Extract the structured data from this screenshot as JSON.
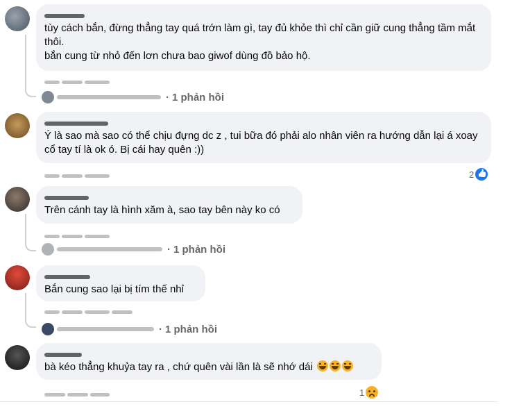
{
  "comments": [
    {
      "text": "tùy cách bắn, đừng thẳng tay quá trớn làm gì, tay đủ khỏe thì chỉ cần giữ cung thẳng tầm mắt thôi.\nbắn cung từ nhỏ đến lơn chưa bao giwof dùng đồ bảo hộ.",
      "reply_count": "1 phản hồi"
    },
    {
      "text": "Ý là sao mà sao có thể chịu đựng dc z , tui bữa đó phải alo nhân viên ra hướng dẫn lại á xoay cổ tay tí là ok ó. Bị cái hay quên :))",
      "reaction_count": "2",
      "reaction_icon": "like-icon"
    },
    {
      "text": "Trên cánh tay là hình xăm à, sao tay bên này ko có",
      "reply_count": "1 phản hồi"
    },
    {
      "text": "Bắn cung sao lại bị tím thế nhỉ",
      "reply_count": "1 phản hồi"
    },
    {
      "text": "bà kéo thẳng khuỷa tay ra , chứ quên vài lần là sẽ nhớ dái",
      "reaction_count": "1",
      "reaction_icon": "sad-icon"
    }
  ],
  "separator": "·",
  "colors": {
    "bubble": "#f0f2f5",
    "meta": "#65676b",
    "like": "#1877f2"
  }
}
